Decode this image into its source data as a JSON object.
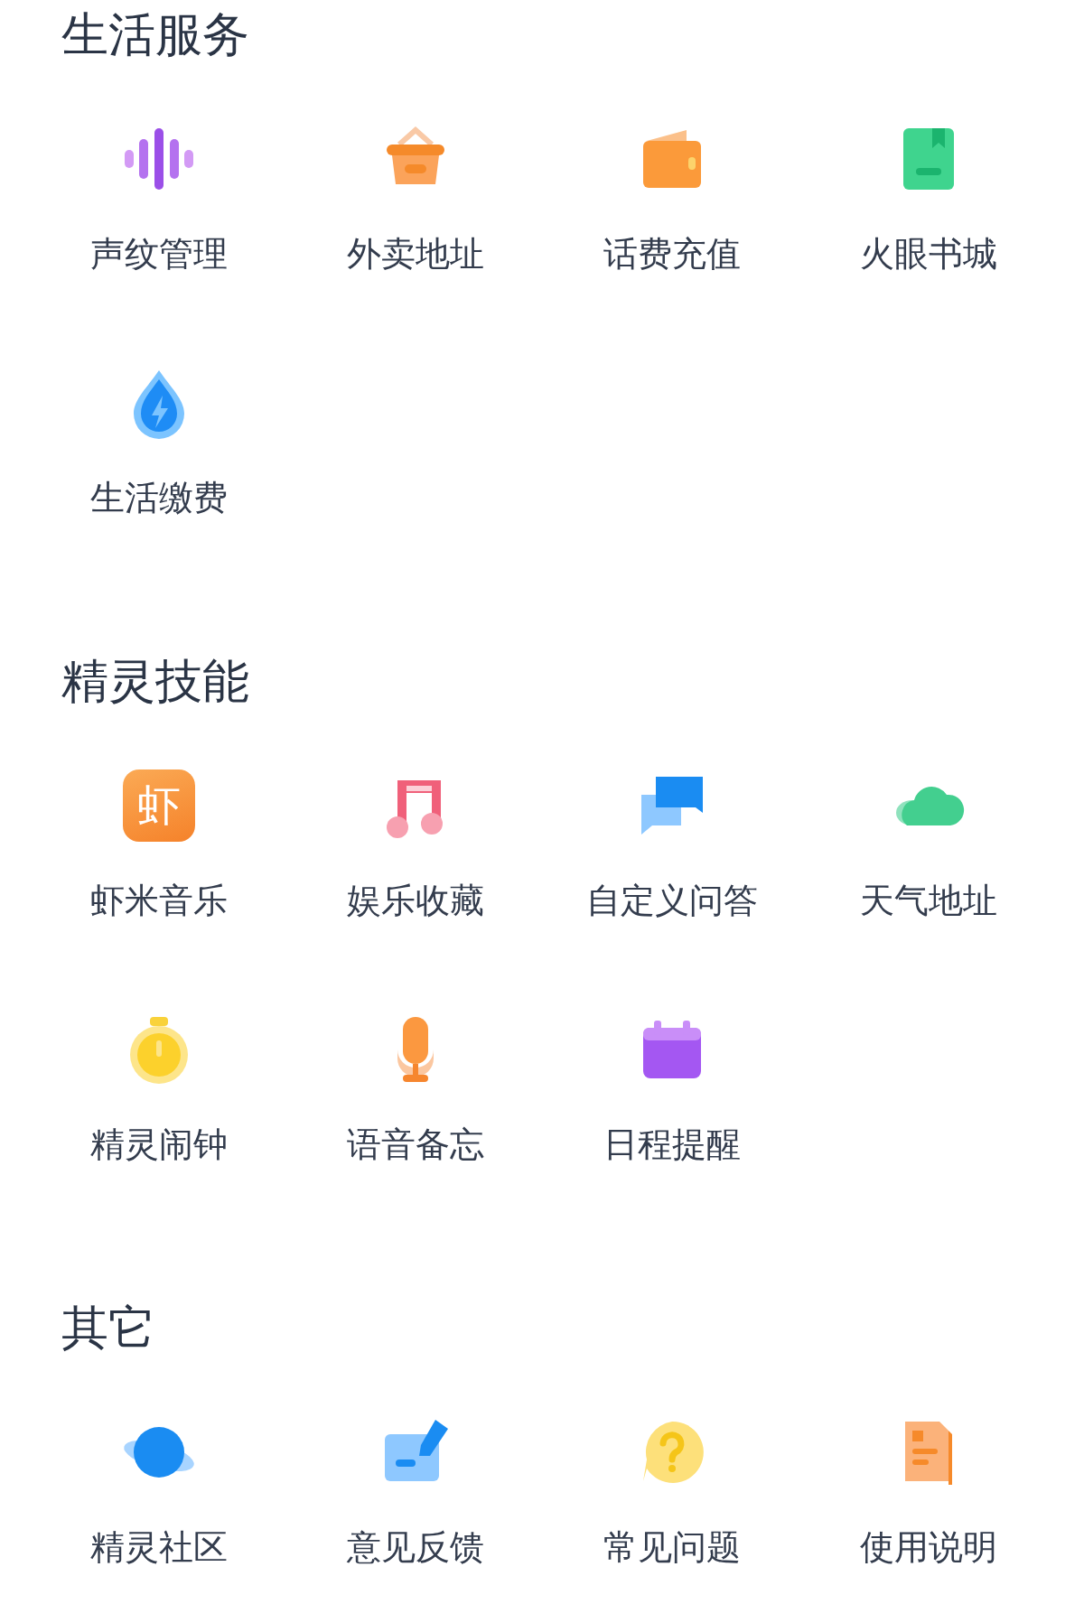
{
  "sections": [
    {
      "title": "生活服务",
      "items": [
        {
          "label": "声纹管理",
          "kind": "voiceprint"
        },
        {
          "label": "外卖地址",
          "kind": "basket"
        },
        {
          "label": "话费充值",
          "kind": "wallet"
        },
        {
          "label": "火眼书城",
          "kind": "book"
        },
        {
          "label": "生活缴费",
          "kind": "drop"
        }
      ]
    },
    {
      "title": "精灵技能",
      "items": [
        {
          "label": "虾米音乐",
          "kind": "music-app",
          "glyph": "虾"
        },
        {
          "label": "娱乐收藏",
          "kind": "note"
        },
        {
          "label": "自定义问答",
          "kind": "chat"
        },
        {
          "label": "天气地址",
          "kind": "cloud"
        },
        {
          "label": "精灵闹钟",
          "kind": "stopwatch"
        },
        {
          "label": "语音备忘",
          "kind": "mic"
        },
        {
          "label": "日程提醒",
          "kind": "calendar"
        }
      ]
    },
    {
      "title": "其它",
      "items": [
        {
          "label": "精灵社区",
          "kind": "planet"
        },
        {
          "label": "意见反馈",
          "kind": "feedback"
        },
        {
          "label": "常见问题",
          "kind": "question"
        },
        {
          "label": "使用说明",
          "kind": "document"
        }
      ]
    }
  ]
}
